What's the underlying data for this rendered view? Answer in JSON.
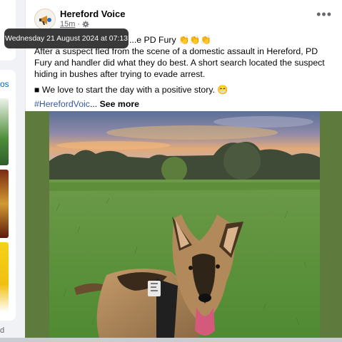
{
  "post": {
    "author": "Hereford Voice",
    "time": "15m",
    "privacy_icon": "gear-icon",
    "tooltip": "Wednesday 21 August 2024 at 07:13",
    "title_line": "...e PD Fury 👏👏👏",
    "paragraph": "After a suspect fled from the scene of a domestic assault in Hereford, PD Fury and handler did what they do best. A short search located the suspect hiding in bushes after trying to evade arrest.",
    "bullet": "■ We love to start the day with a positive story. 😁",
    "hashtag": "#HerefordVoic",
    "ellipsis": "...",
    "see_more": "See more",
    "more_menu_icon": "more-horizontal-icon",
    "photo_alt": "German Shepherd police dog lying on grass at sunrise"
  },
  "left_column": {
    "link_fragment": "os",
    "bottom_fragment": "d"
  },
  "colors": {
    "link": "#385898",
    "photo_border": "#5e7a3c"
  }
}
